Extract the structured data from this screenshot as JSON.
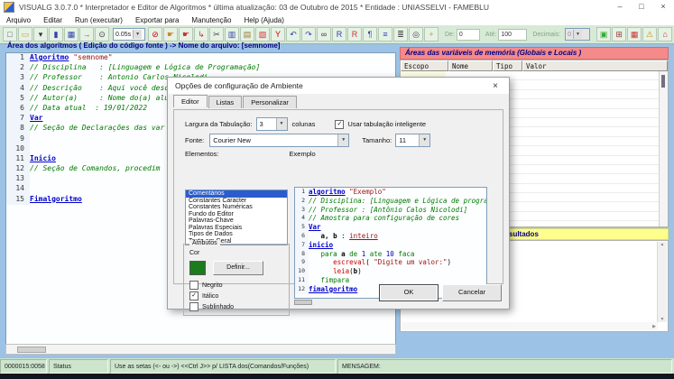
{
  "titlebar": {
    "title": "VISUALG 3.0.7.0 * Interpretador e Editor de Algoritmos * última atualização: 03 de Outubro de 2015 * Entidade : UNIASSELVI - FAMEBLU",
    "minimize": "–",
    "maximize": "□",
    "close": "×"
  },
  "menubar": {
    "items": [
      "Arquivo",
      "Editar",
      "Run (executar)",
      "Exportar para",
      "Manutenção",
      "Help (Ajuda)"
    ]
  },
  "toolbar": {
    "left_buttons": [
      {
        "name": "new-file-button",
        "g": "□",
        "c": "#556"
      },
      {
        "name": "open-file-button",
        "g": "▭",
        "c": "#c93"
      },
      {
        "name": "open-file-dropdown",
        "g": "▾",
        "c": "#333"
      },
      {
        "name": "save-button",
        "g": "▮",
        "c": "#34a"
      },
      {
        "name": "show-variables-button",
        "g": "▦",
        "c": "#34a"
      },
      {
        "name": "step-run-button",
        "g": "→",
        "c": "#c33"
      },
      {
        "name": "timer-button",
        "g": "⊙",
        "c": "#333"
      }
    ],
    "speed_value": "0.05s",
    "mid_buttons": [
      {
        "name": "stop-button",
        "g": "⊘",
        "c": "#c00"
      },
      {
        "name": "pointer-button",
        "g": "☛",
        "c": "#c83"
      },
      {
        "name": "breakpoint-button",
        "g": "☛",
        "c": "#c33"
      },
      {
        "name": "run-to-cursor-button",
        "g": "↳",
        "c": "#c33"
      },
      {
        "name": "cut-button",
        "g": "✂",
        "c": "#444"
      },
      {
        "name": "copy-button",
        "g": "▥",
        "c": "#34a"
      },
      {
        "name": "paste-button",
        "g": "▤",
        "c": "#973"
      },
      {
        "name": "paste-special-button",
        "g": "▧",
        "c": "#c33"
      },
      {
        "name": "syntax-check-button",
        "g": "Y",
        "c": "#c00"
      },
      {
        "name": "undo-button",
        "g": "↶",
        "c": "#34a"
      },
      {
        "name": "redo-button",
        "g": "↷",
        "c": "#34a"
      },
      {
        "name": "find-button",
        "g": "∞",
        "c": "#333"
      },
      {
        "name": "find-next-button",
        "g": "R",
        "c": "#34a"
      },
      {
        "name": "replace-button",
        "g": "R",
        "c": "#c33"
      },
      {
        "name": "goto-line-button",
        "g": "¶",
        "c": "#34a"
      },
      {
        "name": "indent-button",
        "g": "≡",
        "c": "#34a"
      },
      {
        "name": "print-button",
        "g": "≣",
        "c": "#444"
      },
      {
        "name": "print-preview-button",
        "g": "◎",
        "c": "#444"
      },
      {
        "name": "search-wand-button",
        "g": "+",
        "c": "#c93"
      }
    ],
    "range": {
      "de_label": "De:",
      "de_value": "0",
      "ate_label": "Até:",
      "ate_value": "100",
      "dec_label": "Decimais:",
      "dec_value": "0"
    },
    "right_buttons": [
      {
        "name": "picture-button",
        "g": "▣",
        "c": "#3a3"
      },
      {
        "name": "calculator-button",
        "g": "⊞",
        "c": "#933"
      },
      {
        "name": "grid-button",
        "g": "▦",
        "c": "#c33"
      },
      {
        "name": "warning-button",
        "g": "⚠",
        "c": "#c80"
      },
      {
        "name": "exit-button",
        "g": "⌂",
        "c": "#c33"
      }
    ]
  },
  "editor": {
    "panel_title": "Área dos algoritmos ( Edição do código fonte ) -> Nome do arquivo: [semnome]",
    "lines": [
      {
        "n": "1",
        "seg": [
          [
            "kw",
            "Algoritmo"
          ],
          [
            "pl",
            " "
          ],
          [
            "str",
            "\"semnome\""
          ]
        ]
      },
      {
        "n": "2",
        "seg": [
          [
            "cm",
            "// Disciplina   : [Linguagem e Lógica de Programação]"
          ]
        ]
      },
      {
        "n": "3",
        "seg": [
          [
            "cm",
            "// Professor    : Antonio Carlos Nicolodi"
          ]
        ]
      },
      {
        "n": "4",
        "seg": [
          [
            "cm",
            "// Descrição    : Aqui você desc"
          ]
        ]
      },
      {
        "n": "5",
        "seg": [
          [
            "cm",
            "// Autor(a)     : Nome do(a) alu"
          ]
        ]
      },
      {
        "n": "6",
        "seg": [
          [
            "cm",
            "// Data atual  : 19/01/2022"
          ]
        ]
      },
      {
        "n": "7",
        "seg": [
          [
            "kw",
            "Var"
          ]
        ]
      },
      {
        "n": "8",
        "seg": [
          [
            "cm",
            "// Seção de Declarações das var"
          ]
        ]
      },
      {
        "n": "9",
        "seg": []
      },
      {
        "n": "10",
        "seg": []
      },
      {
        "n": "11",
        "seg": [
          [
            "kw",
            "Inicio"
          ]
        ]
      },
      {
        "n": "12",
        "seg": [
          [
            "cm",
            "// Seção de Comandos, procedim"
          ]
        ]
      },
      {
        "n": "13",
        "seg": []
      },
      {
        "n": "14",
        "seg": []
      },
      {
        "n": "15",
        "seg": [
          [
            "kw",
            "Fimalgoritmo"
          ]
        ]
      }
    ]
  },
  "vars_panel": {
    "title": "Áreas das variáveis de memória (Globais e Locais )",
    "columns": [
      "Escopo",
      "Nome",
      "Tipo",
      "Valor"
    ],
    "row_count": 18
  },
  "results_panel": {
    "visible_title": "sultados"
  },
  "dialog": {
    "title": "Opções de configuração de Ambiente",
    "close": "×",
    "tabs": [
      "Editor",
      "Listas",
      "Personalizar"
    ],
    "active_tab": 0,
    "tab_width_label": "Largura da Tabulação:",
    "tab_width_value": "3",
    "columns_label": "colunas",
    "smart_tab_label": "Usar tabulação inteligente",
    "smart_tab_checked": true,
    "font_label": "Fonte:",
    "font_value": "Courier New",
    "size_label": "Tamanho:",
    "size_value": "11",
    "elements_label": "Elementos:",
    "example_label": "Exemplo",
    "elements": [
      "Comentários",
      "Constantes Caracter",
      "Constantes Numéricas",
      "Fundo do Editor",
      "Palavras-Chave",
      "Palavras Especiais",
      "Tipos de Dados",
      "Texto em Geral"
    ],
    "selected_element": 0,
    "attributes": {
      "title": "Atributos",
      "color_label": "Cor",
      "swatch_color": "#1c7c1c",
      "define_button": "Definir...",
      "bold_label": "Negrito",
      "bold_checked": false,
      "italic_label": "Itálico",
      "italic_checked": true,
      "underline_label": "Sublinhado",
      "underline_checked": false
    },
    "example_lines": [
      {
        "n": "1",
        "seg": [
          [
            "kw",
            "algoritmo"
          ],
          [
            "pl",
            " "
          ],
          [
            "str",
            "\"Exemplo\""
          ]
        ]
      },
      {
        "n": "2",
        "seg": [
          [
            "cm",
            "// Disciplina: [Linguagem e Lógica de progra"
          ]
        ]
      },
      {
        "n": "3",
        "seg": [
          [
            "cm",
            "// Professor : [Antônio Calos Nicolodi]"
          ]
        ]
      },
      {
        "n": "4",
        "seg": [
          [
            "cm",
            "// Amostra para configuração de cores"
          ]
        ]
      },
      {
        "n": "5",
        "seg": [
          [
            "kw",
            "Var"
          ]
        ]
      },
      {
        "n": "6",
        "seg": [
          [
            "pl",
            "   "
          ],
          [
            "id",
            "a, b"
          ],
          [
            "pl",
            " : "
          ],
          [
            "ty",
            "inteiro"
          ]
        ]
      },
      {
        "n": "7",
        "seg": [
          [
            "kw",
            "inicio"
          ]
        ]
      },
      {
        "n": "8",
        "seg": [
          [
            "pl",
            "   "
          ],
          [
            "gr",
            "para"
          ],
          [
            "pl",
            " "
          ],
          [
            "id",
            "a"
          ],
          [
            "pl",
            " "
          ],
          [
            "gr",
            "de"
          ],
          [
            "pl",
            " "
          ],
          [
            "num",
            "1"
          ],
          [
            "pl",
            " "
          ],
          [
            "gr",
            "ate"
          ],
          [
            "pl",
            " "
          ],
          [
            "num",
            "10"
          ],
          [
            "pl",
            " "
          ],
          [
            "gr",
            "faca"
          ]
        ]
      },
      {
        "n": "9",
        "seg": [
          [
            "pl",
            "      "
          ],
          [
            "sp",
            "escreval"
          ],
          [
            "pl",
            "( "
          ],
          [
            "str",
            "\"Digite um valor:\""
          ],
          [
            "pl",
            ")"
          ]
        ]
      },
      {
        "n": "10",
        "seg": [
          [
            "pl",
            "      "
          ],
          [
            "sp",
            "leia"
          ],
          [
            "pl",
            "("
          ],
          [
            "id",
            "b"
          ],
          [
            "pl",
            ")"
          ]
        ]
      },
      {
        "n": "11",
        "seg": [
          [
            "pl",
            "   "
          ],
          [
            "gr",
            "fimpara"
          ]
        ]
      },
      {
        "n": "12",
        "seg": [
          [
            "kw",
            "fimalgoritmo"
          ]
        ]
      }
    ],
    "ok_button": "OK",
    "cancel_button": "Cancelar"
  },
  "statusbar": {
    "position": "0000015:0058",
    "status": "Status",
    "hint": "Use as setas (<- ou ->) <<Ctrl J>> p/ LISTA dos(Comandos/Funções)",
    "message": "MENSAGEM:"
  }
}
